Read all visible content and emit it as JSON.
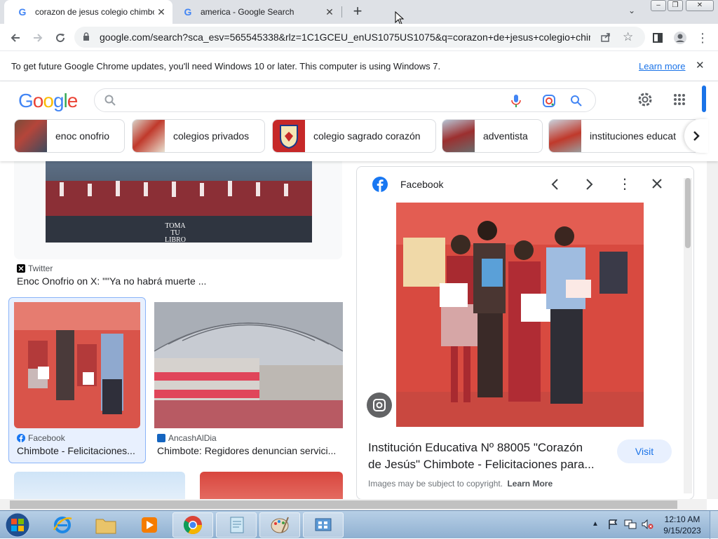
{
  "tabs": [
    {
      "title": "corazon de jesus colegio chimbo",
      "icon": "google-g-icon"
    },
    {
      "title": "america - Google Search",
      "icon": "google-g-icon"
    }
  ],
  "toolbar": {
    "url": "google.com/search?sca_esv=565545338&rlz=1C1GCEU_enUS1075US1075&q=corazon+de+jesus+colegio+chim..."
  },
  "infobar": {
    "message": "To get future Google Chrome updates, you'll need Windows 10 or later. This computer is using Windows 7.",
    "link": "Learn more"
  },
  "google": {
    "logo_letters": [
      "G",
      "o",
      "o",
      "g",
      "l",
      "e"
    ],
    "logo_colors": [
      "#4285f4",
      "#ea4335",
      "#fbbc05",
      "#4285f4",
      "#34a853",
      "#ea4335"
    ],
    "search_value": "",
    "chips": [
      {
        "label": "enoc onofrio"
      },
      {
        "label": "colegios privados"
      },
      {
        "label": "colegio sagrado corazón"
      },
      {
        "label": "adventista"
      },
      {
        "label": "instituciones educat"
      }
    ]
  },
  "results": {
    "banner_text": "TOMA TU LIBRO",
    "twitter": {
      "source": "Twitter",
      "caption": "Enoc Onofrio on X: \"\"Ya no habrá muerte ..."
    },
    "facebook_card": {
      "source": "Facebook",
      "caption": "Chimbote - Felicitaciones..."
    },
    "ancash_card": {
      "source": "AncashAlDia",
      "caption": "Chimbote: Regidores denuncian servici..."
    }
  },
  "panel": {
    "source": "Facebook",
    "title_line1": "Institución Educativa Nº 88005 \"Corazón",
    "title_line2": "de Jesús\" Chimbote - Felicitaciones para...",
    "visit": "Visit",
    "copyright": "Images may be subject to copyright.",
    "learn_more": "Learn More"
  },
  "taskbar": {
    "time": "12:10 AM",
    "date": "9/15/2023"
  }
}
